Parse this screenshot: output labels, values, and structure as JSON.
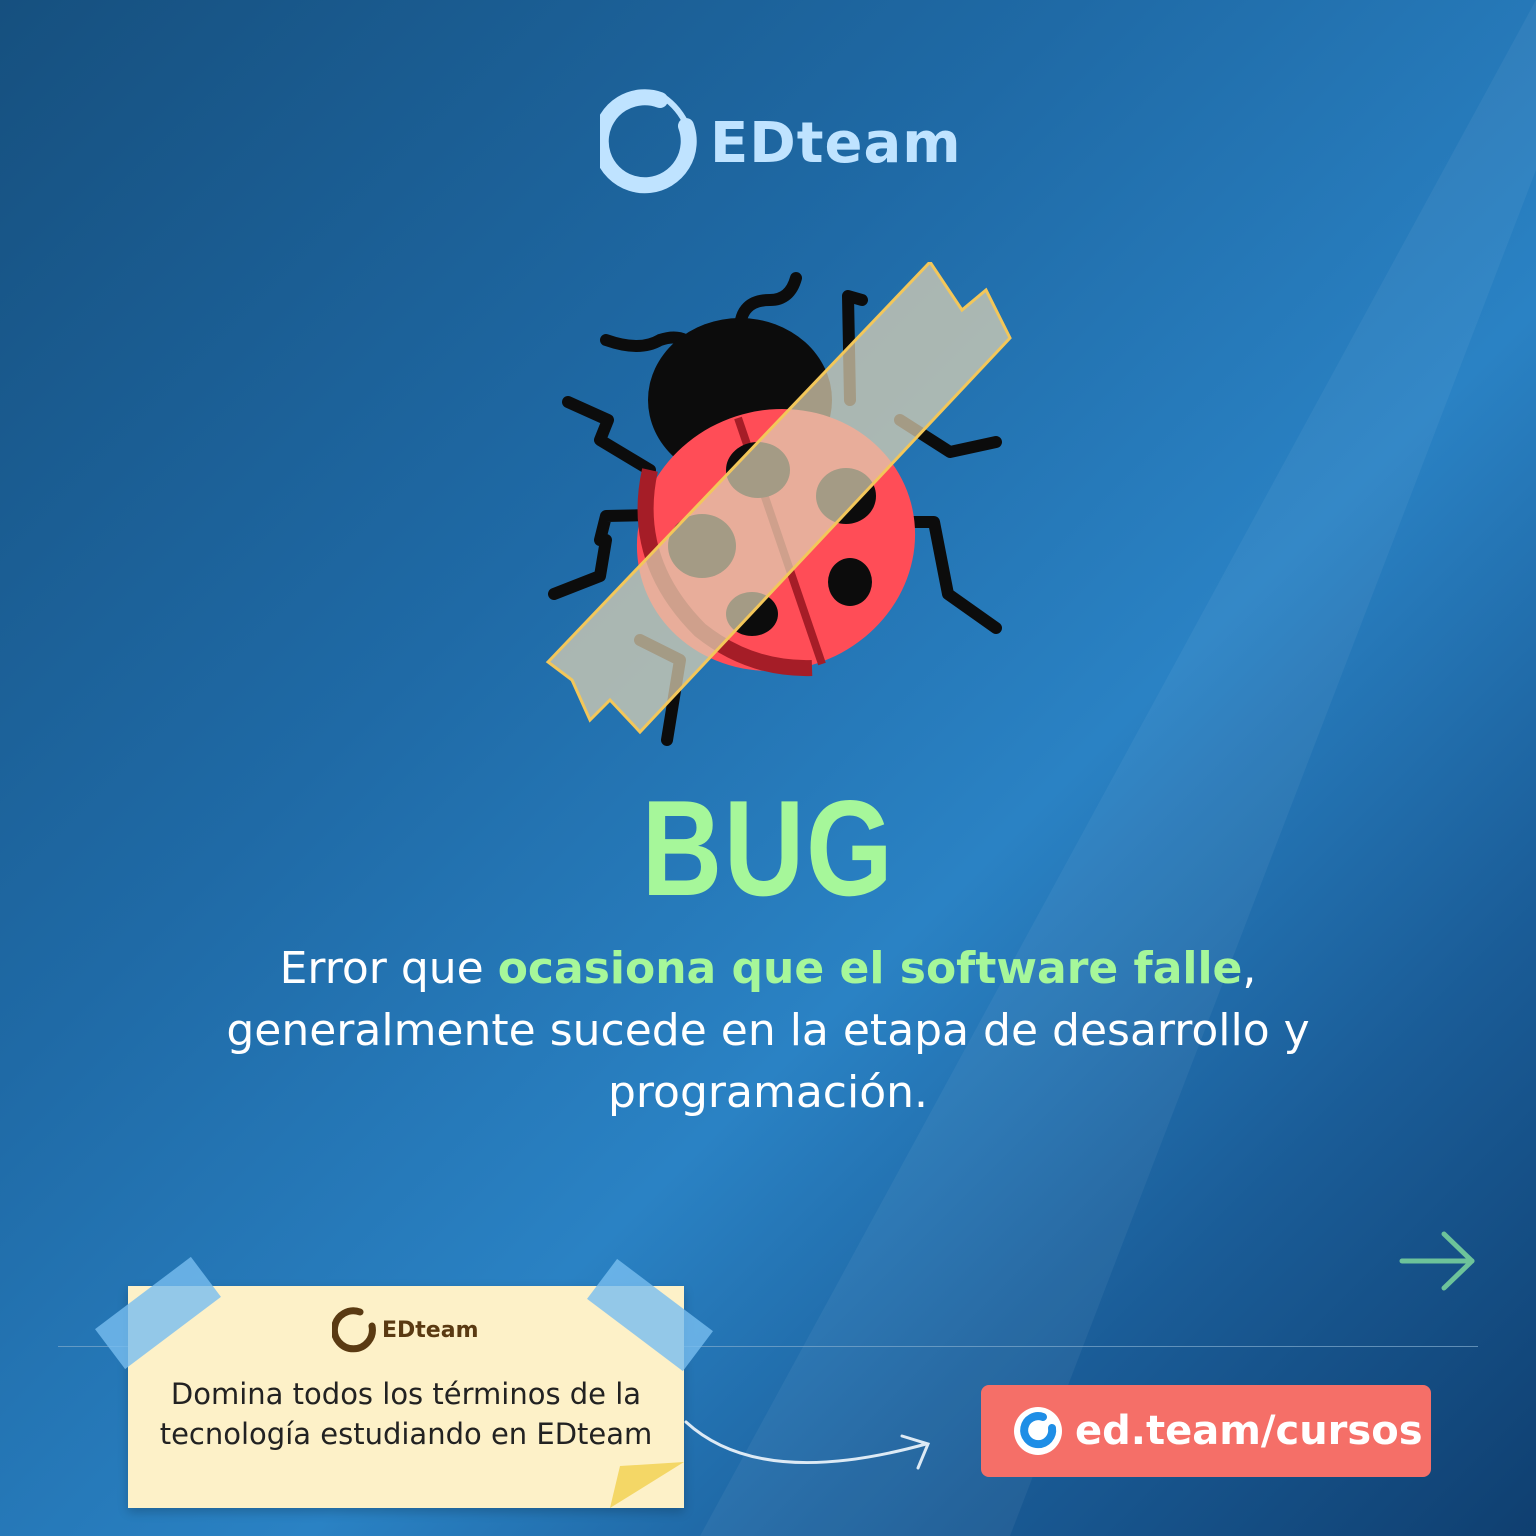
{
  "brand": {
    "name": "EDteam"
  },
  "title": "BUG",
  "description": {
    "part1": "Error que ",
    "highlight": "ocasiona que el software falle",
    "part2": ", generalmente sucede en la etapa de desarrollo y programación."
  },
  "note": {
    "brand": "EDteam",
    "text": "Domina todos los términos de la tecnología estudiando en EDteam"
  },
  "cta": {
    "label": "ed.team/cursos"
  },
  "icons": {
    "logo": "edteam-ring-icon",
    "illustration": "ladybug-taped-icon",
    "next": "arrow-right-icon"
  },
  "colors": {
    "accent_green": "#a6f79a",
    "cta_bg": "#f56f68",
    "logo_blue": "#bfe3ff",
    "note_bg": "#fdf1c8"
  }
}
